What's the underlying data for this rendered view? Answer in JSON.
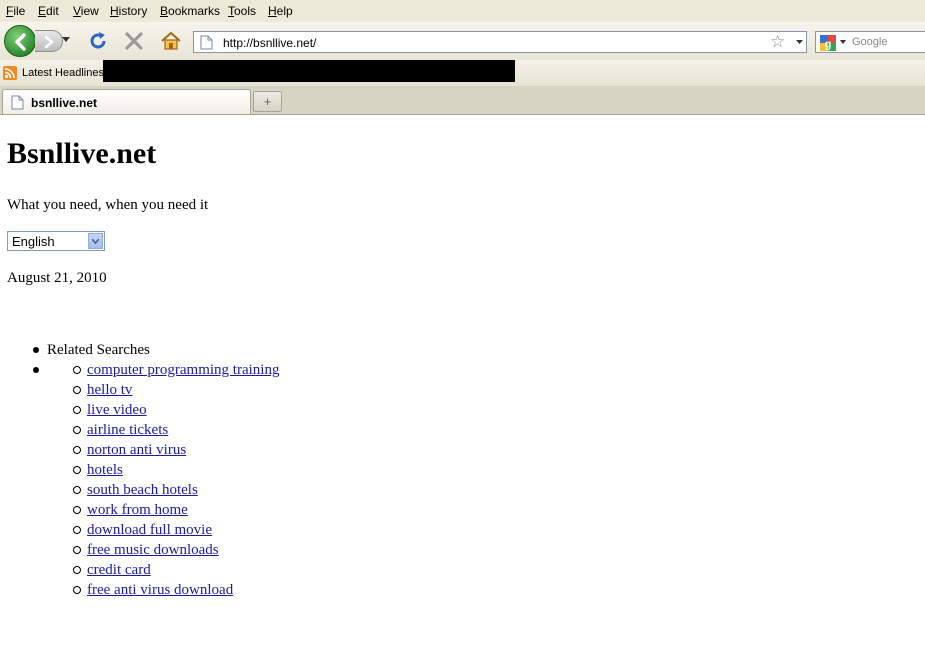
{
  "browser": {
    "menu": [
      "File",
      "Edit",
      "View",
      "History",
      "Bookmarks",
      "Tools",
      "Help"
    ],
    "url": "http://bsnllive.net/",
    "search_placeholder": "Google",
    "bookmark_label": "Latest Headlines",
    "tab_title": "bsnllive.net",
    "new_tab_label": "+"
  },
  "page": {
    "title": "Bsnllive.net",
    "tagline": "What you need, when you need it",
    "language": "English",
    "date": "August 21, 2010",
    "related_heading": "Related Searches",
    "links": [
      "computer programming training",
      "hello tv",
      "live video",
      "airline tickets",
      "norton anti virus",
      "hotels",
      "south beach hotels",
      "work from home",
      "download full movie",
      "free music downloads",
      "credit card",
      "free anti virus download"
    ]
  }
}
